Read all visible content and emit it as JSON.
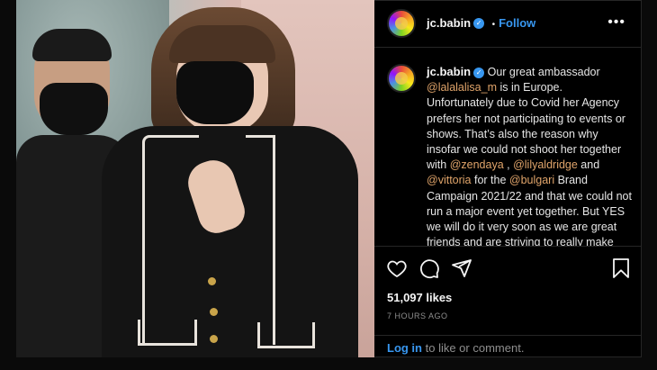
{
  "post": {
    "username": "jc.babin",
    "verified_icon": "verified-badge-icon",
    "separator": "•",
    "follow_label": "Follow",
    "more_label": "•••",
    "caption": {
      "username": "jc.babin",
      "segments": [
        {
          "text": " Our great ambassador ",
          "mention": false
        },
        {
          "text": "@lalalalisa_m",
          "mention": true
        },
        {
          "text": " is in Europe. Unfortunately due to Covid her Agency prefers her not participating to events or shows. That’s also the reason why insofar we could not shoot her together with ",
          "mention": false
        },
        {
          "text": "@zendaya",
          "mention": true
        },
        {
          "text": " , ",
          "mention": false
        },
        {
          "text": "@lilyaldridge",
          "mention": true
        },
        {
          "text": " and ",
          "mention": false
        },
        {
          "text": "@vittoria",
          "mention": true
        },
        {
          "text": " for the ",
          "mention": false
        },
        {
          "text": "@bulgari",
          "mention": true
        },
        {
          "text": " Brand Campaign 2021/22 and that we could not run a major event yet together. But YES we will do it very soon as we are great friends and are striving to really make such a collaboration happen.",
          "mention": false
        }
      ]
    },
    "likes": "51,097 likes",
    "timestamp": "7 HOURS AGO",
    "comment": {
      "login_label": "Log in",
      "rest_label": " to like or comment."
    }
  },
  "colors": {
    "link": "#3897f0",
    "mention": "#e0a46a",
    "background": "#000000"
  },
  "icons": [
    "heart-icon",
    "comment-icon",
    "share-icon",
    "bookmark-icon",
    "more-options-icon",
    "avatar"
  ]
}
